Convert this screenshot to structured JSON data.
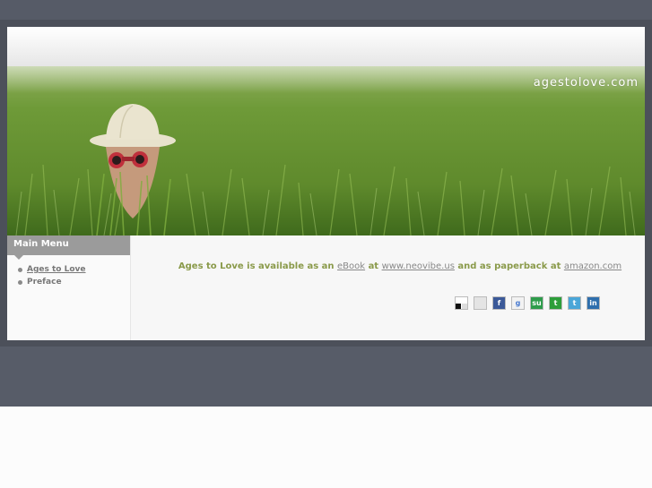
{
  "site": {
    "title": "agestolove.com"
  },
  "sidebar": {
    "header": "Main Menu",
    "items": [
      {
        "label": "Ages to Love"
      },
      {
        "label": "Preface"
      }
    ]
  },
  "content": {
    "text1": "Ages to Love is available as an",
    "link_ebook": "eBook",
    "text2": "at",
    "link_neovibe": "www.neovibe.us",
    "text3": "and as paperback at",
    "link_amazon": "amazon.com"
  },
  "social": {
    "icons": [
      "delicious-icon",
      "digg-icon",
      "facebook-icon",
      "google-icon",
      "stumbleupon-icon",
      "technorati-icon",
      "twitter-icon",
      "linkedin-icon"
    ],
    "labels": {
      "facebook": "f",
      "google": "g",
      "stumbleupon": "su",
      "technorati": "t",
      "twitter": "t",
      "linkedin": "in"
    }
  },
  "colors": {
    "frame": "#4c505a",
    "menu_header": "#9b9b9b",
    "accent_text": "#8a9a4a",
    "grass": "#5f8a30"
  }
}
